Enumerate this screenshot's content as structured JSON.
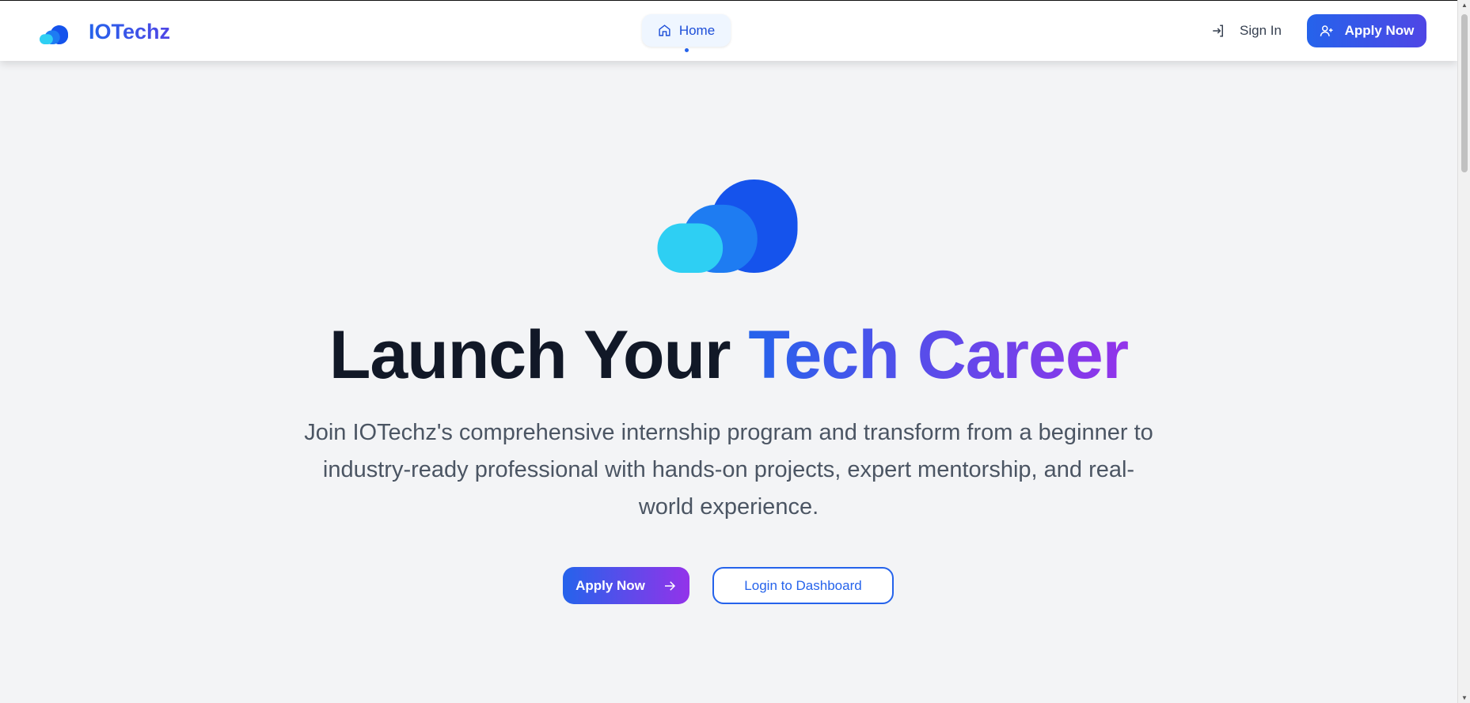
{
  "header": {
    "brand": "IOTechz",
    "nav": [
      {
        "label": "Home",
        "icon": "home-icon",
        "active": true
      }
    ],
    "sign_in": "Sign In",
    "apply_now": "Apply Now"
  },
  "hero": {
    "title_plain": "Launch Your",
    "title_highlight": "Tech Career",
    "subtitle": "Join IOTechz's comprehensive internship program and transform from a beginner to industry-ready professional with hands-on projects, expert mentorship, and real-world experience.",
    "primary_button": "Apply Now",
    "secondary_button": "Login to Dashboard"
  },
  "colors": {
    "accent": "#2563eb",
    "accent_end": "#9333ea",
    "background": "#f3f4f6"
  }
}
